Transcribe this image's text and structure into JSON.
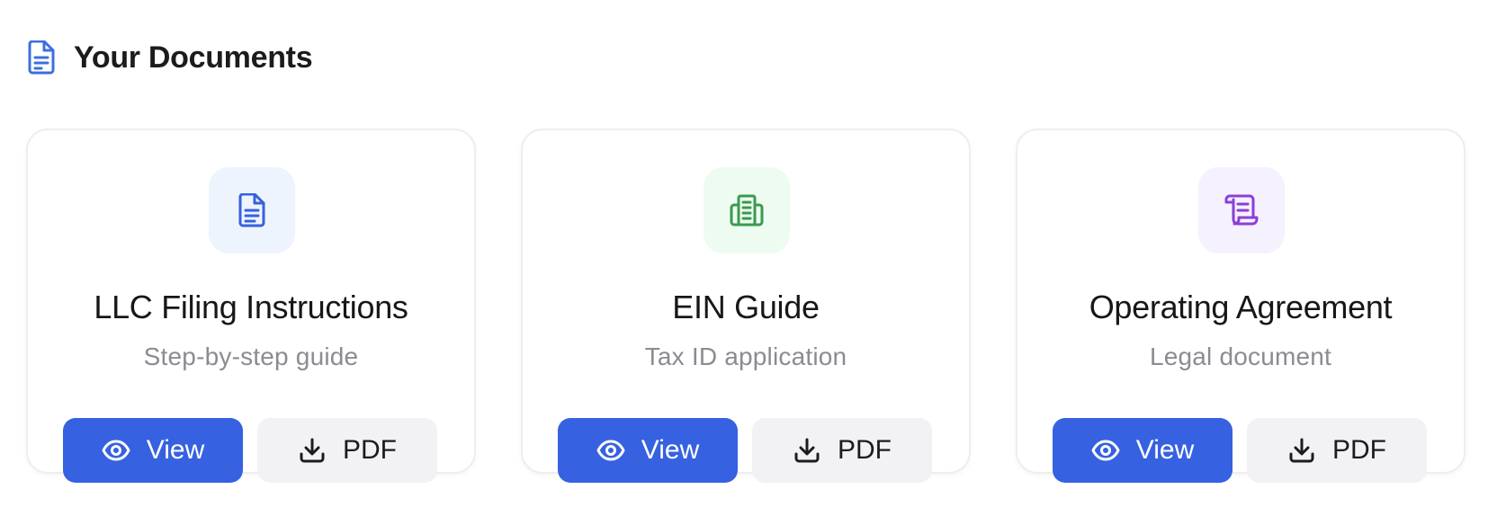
{
  "header": {
    "title": "Your Documents",
    "icon": "document-icon",
    "icon_color": "#3b6fe0"
  },
  "documents": [
    {
      "title": "LLC Filing Instructions",
      "subtitle": "Step-by-step guide",
      "icon": "document-icon",
      "icon_color": "#3661e0",
      "icon_bg": "#eef4fe",
      "view_label": "View",
      "pdf_label": "PDF"
    },
    {
      "title": "EIN Guide",
      "subtitle": "Tax ID application",
      "icon": "building-icon",
      "icon_color": "#3a9a4f",
      "icon_bg": "#eefbf1",
      "view_label": "View",
      "pdf_label": "PDF"
    },
    {
      "title": "Operating Agreement",
      "subtitle": "Legal document",
      "icon": "scroll-icon",
      "icon_color": "#8a3fd8",
      "icon_bg": "#f6f1fe",
      "view_label": "View",
      "pdf_label": "PDF"
    }
  ],
  "colors": {
    "primary_button": "#3661e0",
    "secondary_button": "#f2f2f5"
  }
}
